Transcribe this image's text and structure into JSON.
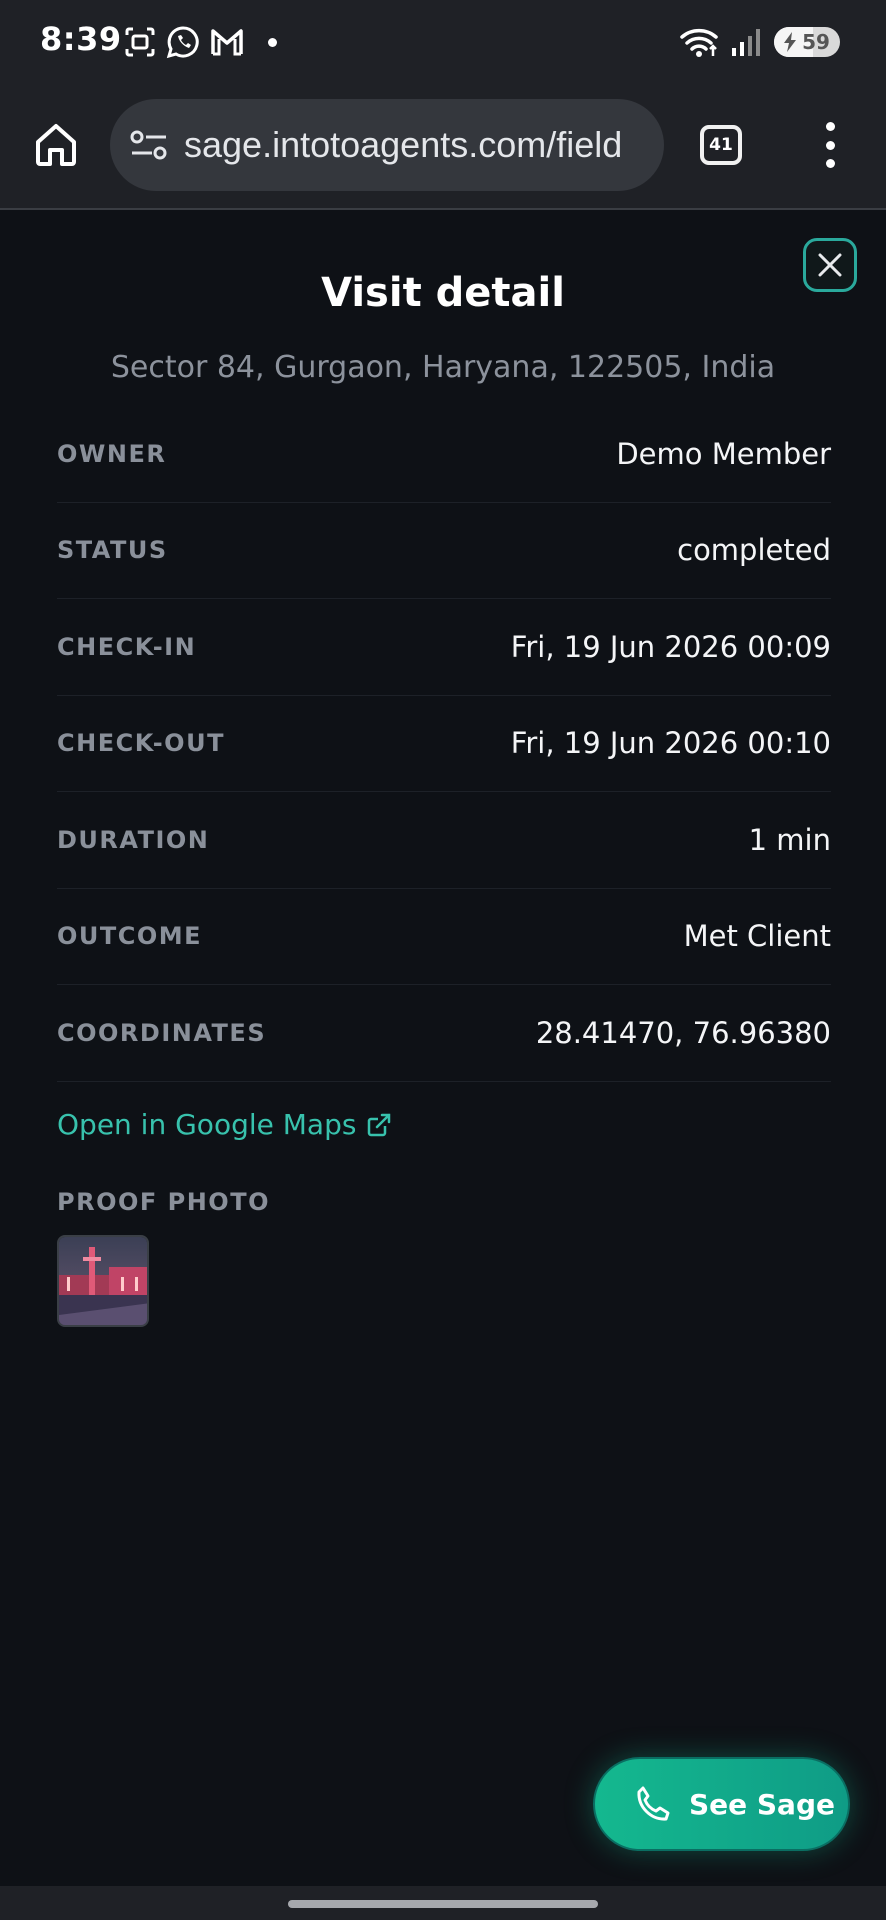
{
  "status_bar": {
    "time": "8:39",
    "battery": "59",
    "battery_level": 0.59
  },
  "browser": {
    "url": "sage.intotoagents.com/field",
    "tab_count": "41"
  },
  "panel": {
    "title": "Visit detail",
    "address": "Sector 84, Gurgaon, Haryana, 122505, India",
    "rows": [
      {
        "label": "OWNER",
        "value": "Demo Member"
      },
      {
        "label": "STATUS",
        "value": "completed"
      },
      {
        "label": "CHECK-IN",
        "value": "Fri, 19 Jun 2026 00:09"
      },
      {
        "label": "CHECK-OUT",
        "value": "Fri, 19 Jun 2026 00:10"
      },
      {
        "label": "DURATION",
        "value": "1 min"
      },
      {
        "label": "OUTCOME",
        "value": "Met Client"
      },
      {
        "label": "COORDINATES",
        "value": "28.41470, 76.96380"
      }
    ],
    "maps_link": "Open in Google Maps",
    "proof_label": "PROOF PHOTO"
  },
  "fab": {
    "label": "See Sage"
  },
  "colors": {
    "accent": "#2aa99c",
    "link": "#38c2ad",
    "background": "#0e1116"
  }
}
